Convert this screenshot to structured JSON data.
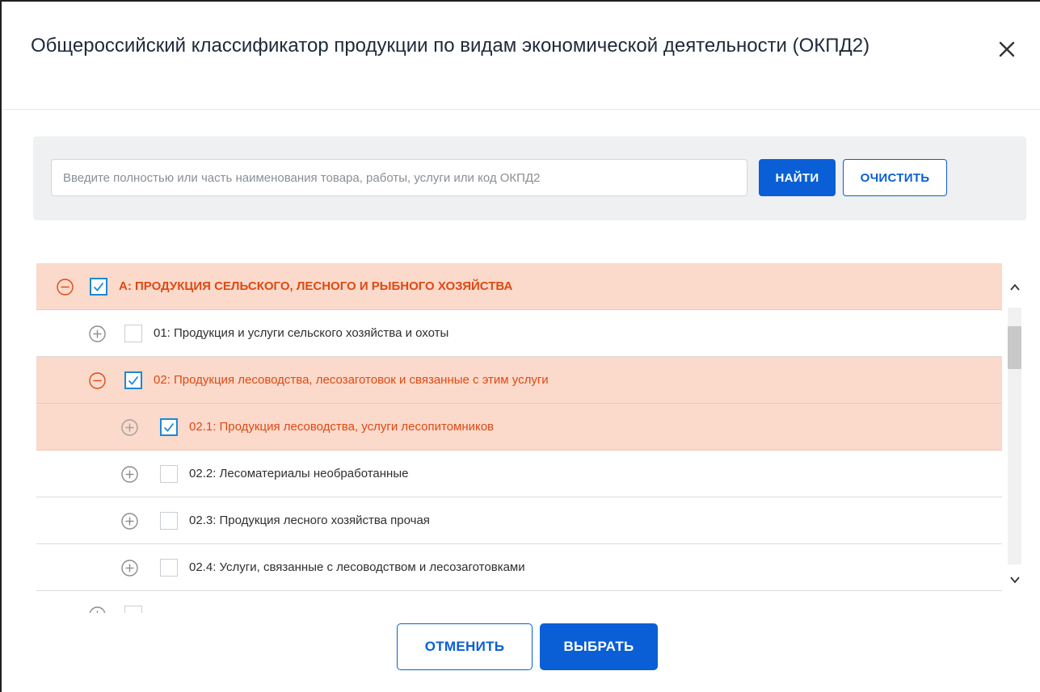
{
  "dialog": {
    "title": "Общероссийский классификатор продукции по видам экономической деятельности (ОКПД2)"
  },
  "search": {
    "placeholder": "Введите полностью или часть наименования товара, работы, услуги или код ОКПД2",
    "value": "",
    "find_label": "НАЙТИ",
    "clear_label": "ОЧИСТИТЬ"
  },
  "tree": {
    "items": [
      {
        "label": "A: ПРОДУКЦИЯ СЕЛЬСКОГО, ЛЕСНОГО И РЫБНОГО ХОЗЯЙСТВА",
        "level": 0,
        "expanded": true,
        "checked": true
      },
      {
        "label": "01: Продукция и услуги сельского хозяйства и охоты",
        "level": 1,
        "expanded": false,
        "checked": false
      },
      {
        "label": "02: Продукция лесоводства, лесозаготовок и связанные с этим услуги",
        "level": 1,
        "expanded": true,
        "checked": true
      },
      {
        "label": "02.1: Продукция лесоводства, услуги лесопитомников",
        "level": 2,
        "expanded": false,
        "checked": true
      },
      {
        "label": "02.2: Лесоматериалы необработанные",
        "level": 2,
        "expanded": false,
        "checked": false
      },
      {
        "label": "02.3: Продукция лесного хозяйства прочая",
        "level": 2,
        "expanded": false,
        "checked": false
      },
      {
        "label": "02.4: Услуги, связанные с лесоводством и лесозаготовками",
        "level": 2,
        "expanded": false,
        "checked": false
      },
      {
        "label": "",
        "level": 1,
        "expanded": false,
        "checked": false
      }
    ]
  },
  "footer": {
    "cancel_label": "ОТМЕНИТЬ",
    "select_label": "ВЫБРАТЬ"
  },
  "colors": {
    "primary": "#0a5fd6",
    "selected_row_bg": "#fbd9cb",
    "selected_text": "#de4a12",
    "checkbox_checked": "#1e88d4"
  }
}
